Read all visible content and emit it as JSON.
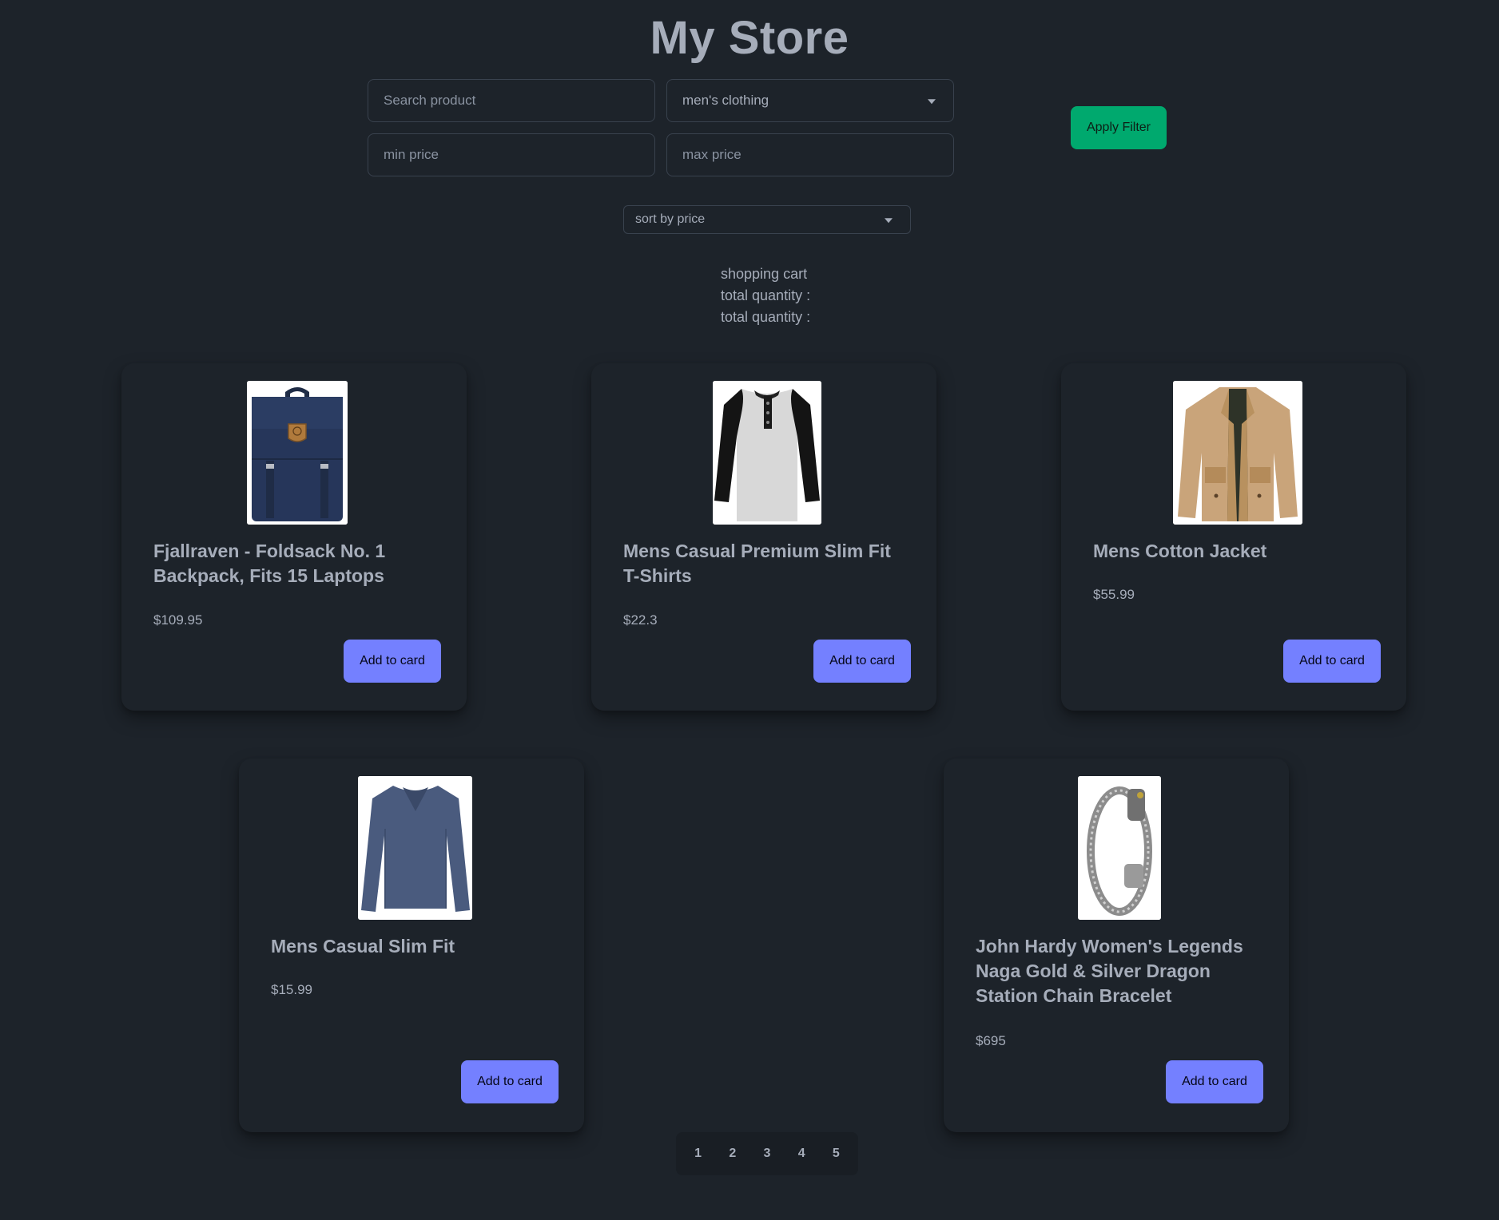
{
  "header": {
    "title": "My Store"
  },
  "filters": {
    "search_placeholder": "Search product",
    "category_selected": "men's clothing",
    "min_price_placeholder": "min price",
    "max_price_placeholder": "max price",
    "apply_label": "Apply Filter",
    "sort_selected": "sort by price"
  },
  "cart": {
    "title": "shopping cart",
    "line1": "total quantity :",
    "line2": "total quantity :"
  },
  "products": [
    {
      "name": "Fjallraven - Foldsack No. 1 Backpack, Fits 15 Laptops",
      "price": "$109.95",
      "button": "Add to card",
      "image": "backpack"
    },
    {
      "name": "Mens Casual Premium Slim Fit T-Shirts",
      "price": "$22.3",
      "button": "Add to card",
      "image": "raglan-shirt"
    },
    {
      "name": "Mens Cotton Jacket",
      "price": "$55.99",
      "button": "Add to card",
      "image": "jacket"
    },
    {
      "name": "Mens Casual Slim Fit",
      "price": "$15.99",
      "button": "Add to card",
      "image": "long-sleeve-shirt"
    },
    {
      "name": "John Hardy Women's Legends Naga Gold & Silver Dragon Station Chain Bracelet",
      "price": "$695",
      "button": "Add to card",
      "image": "bracelet"
    }
  ],
  "pagination": {
    "pages": [
      "1",
      "2",
      "3",
      "4",
      "5"
    ]
  },
  "colors": {
    "background": "#1d232a",
    "primary": "#7480ff",
    "success": "#00a96e",
    "text": "#a6adba"
  }
}
